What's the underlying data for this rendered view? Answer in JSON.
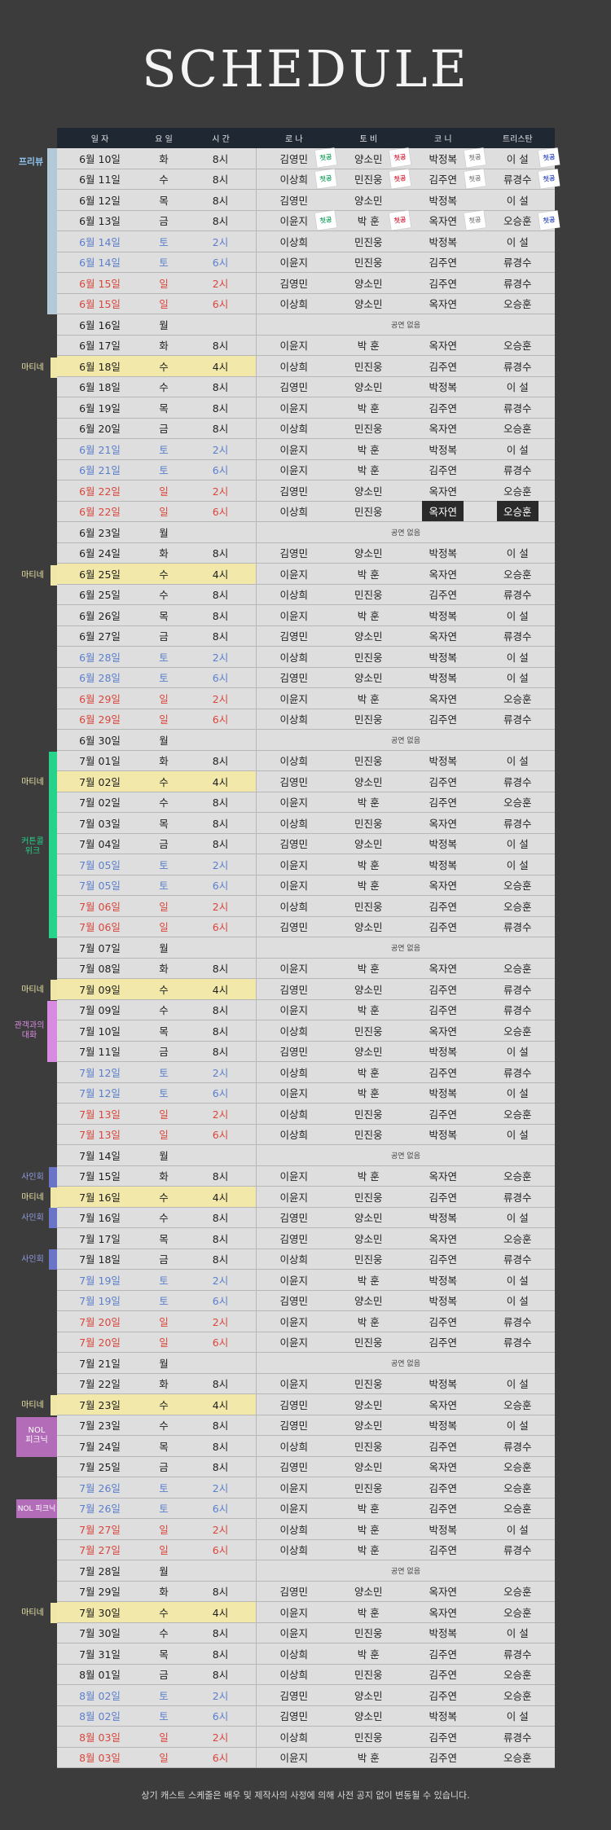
{
  "title": "SCHEDULE",
  "headers": [
    "일 자",
    "요 일",
    "시 간",
    "로 나",
    "토 비",
    "코 니",
    "트리스탄"
  ],
  "footer_note": "상기 캐스트 스케줄은 배우 및 제작사의 사정에 의해 사전 공지 없이 변동될 수 있습니다.",
  "side_labels": {
    "preview": "프리뷰",
    "matinee": "마티네",
    "curtain_call": [
      "커튼콜",
      "위크"
    ],
    "talk": [
      "관객과의",
      "대화"
    ],
    "signing": "사인회",
    "nol1": [
      "NOL",
      "피크닉"
    ],
    "nol2": "NOL 피크닉"
  },
  "colors": {
    "preview": "#b3c9d7",
    "matinee": "#efe6a7",
    "curtain_call": "#27d38a",
    "talk": "#d88be0",
    "signing": "#6b75c8",
    "nol": "#b36cb8"
  },
  "rows": [
    {
      "date": "6월 10일",
      "day": "화",
      "time": "8시",
      "cast": [
        "김영민",
        "양소민",
        "박정복",
        "이 설"
      ],
      "badges": [
        "green",
        "red",
        "gray",
        "blue"
      ]
    },
    {
      "date": "6월 11일",
      "day": "수",
      "time": "8시",
      "cast": [
        "이상희",
        "민진웅",
        "김주연",
        "류경수"
      ],
      "badges": [
        "green",
        "red",
        "gray",
        "blue"
      ]
    },
    {
      "date": "6월 12일",
      "day": "목",
      "time": "8시",
      "cast": [
        "김영민",
        "양소민",
        "박정복",
        "이 설"
      ]
    },
    {
      "date": "6월 13일",
      "day": "금",
      "time": "8시",
      "cast": [
        "이윤지",
        "박 훈",
        "옥자연",
        "오승훈"
      ],
      "badges": [
        "green",
        "red",
        "gray",
        "blue"
      ]
    },
    {
      "date": "6월 14일",
      "day": "토",
      "time": "2시",
      "type": "sat",
      "cast": [
        "이상희",
        "민진웅",
        "박정복",
        "이 설"
      ]
    },
    {
      "date": "6월 14일",
      "day": "토",
      "time": "6시",
      "type": "sat",
      "cast": [
        "이윤지",
        "민진웅",
        "김주연",
        "류경수"
      ]
    },
    {
      "date": "6월 15일",
      "day": "일",
      "time": "2시",
      "type": "sun",
      "cast": [
        "김영민",
        "양소민",
        "김주연",
        "류경수"
      ]
    },
    {
      "date": "6월 15일",
      "day": "일",
      "time": "6시",
      "type": "sun",
      "cast": [
        "이상희",
        "양소민",
        "옥자연",
        "오승훈"
      ]
    },
    {
      "date": "6월 16일",
      "day": "월",
      "off": "공연 없음"
    },
    {
      "date": "6월 17일",
      "day": "화",
      "time": "8시",
      "cast": [
        "이윤지",
        "박 훈",
        "옥자연",
        "오승훈"
      ]
    },
    {
      "date": "6월 18일",
      "day": "수",
      "time": "4시",
      "mat": true,
      "cast": [
        "이상희",
        "민진웅",
        "김주연",
        "류경수"
      ]
    },
    {
      "date": "6월 18일",
      "day": "수",
      "time": "8시",
      "cast": [
        "김영민",
        "양소민",
        "박정복",
        "이 설"
      ]
    },
    {
      "date": "6월 19일",
      "day": "목",
      "time": "8시",
      "cast": [
        "이윤지",
        "박 훈",
        "김주연",
        "류경수"
      ]
    },
    {
      "date": "6월 20일",
      "day": "금",
      "time": "8시",
      "cast": [
        "이상희",
        "민진웅",
        "옥자연",
        "오승훈"
      ]
    },
    {
      "date": "6월 21일",
      "day": "토",
      "time": "2시",
      "type": "sat",
      "cast": [
        "이윤지",
        "박 훈",
        "박정복",
        "이 설"
      ]
    },
    {
      "date": "6월 21일",
      "day": "토",
      "time": "6시",
      "type": "sat",
      "cast": [
        "이윤지",
        "박 훈",
        "김주연",
        "류경수"
      ]
    },
    {
      "date": "6월 22일",
      "day": "일",
      "time": "2시",
      "type": "sun",
      "cast": [
        "김영민",
        "양소민",
        "옥자연",
        "오승훈"
      ]
    },
    {
      "date": "6월 22일",
      "day": "일",
      "time": "6시",
      "type": "sun",
      "cast": [
        "이상희",
        "민진웅",
        "옥자연",
        "오승훈"
      ],
      "dark": [
        2,
        3
      ]
    },
    {
      "date": "6월 23일",
      "day": "월",
      "off": "공연 없음"
    },
    {
      "date": "6월 24일",
      "day": "화",
      "time": "8시",
      "cast": [
        "김영민",
        "양소민",
        "박정복",
        "이 설"
      ]
    },
    {
      "date": "6월 25일",
      "day": "수",
      "time": "4시",
      "mat": true,
      "cast": [
        "이윤지",
        "박 훈",
        "옥자연",
        "오승훈"
      ]
    },
    {
      "date": "6월 25일",
      "day": "수",
      "time": "8시",
      "cast": [
        "이상희",
        "민진웅",
        "김주연",
        "류경수"
      ]
    },
    {
      "date": "6월 26일",
      "day": "목",
      "time": "8시",
      "cast": [
        "이윤지",
        "박 훈",
        "박정복",
        "이 설"
      ]
    },
    {
      "date": "6월 27일",
      "day": "금",
      "time": "8시",
      "cast": [
        "김영민",
        "양소민",
        "옥자연",
        "류경수"
      ]
    },
    {
      "date": "6월 28일",
      "day": "토",
      "time": "2시",
      "type": "sat",
      "cast": [
        "이상희",
        "민진웅",
        "박정복",
        "이 설"
      ]
    },
    {
      "date": "6월 28일",
      "day": "토",
      "time": "6시",
      "type": "sat",
      "cast": [
        "김영민",
        "양소민",
        "박정복",
        "이 설"
      ]
    },
    {
      "date": "6월 29일",
      "day": "일",
      "time": "2시",
      "type": "sun",
      "cast": [
        "이윤지",
        "박 훈",
        "옥자연",
        "오승훈"
      ]
    },
    {
      "date": "6월 29일",
      "day": "일",
      "time": "6시",
      "type": "sun",
      "cast": [
        "이상희",
        "민진웅",
        "김주연",
        "류경수"
      ]
    },
    {
      "date": "6월 30일",
      "day": "월",
      "off": "공연 없음"
    },
    {
      "date": "7월 01일",
      "day": "화",
      "time": "8시",
      "cast": [
        "이상희",
        "민진웅",
        "박정복",
        "이 설"
      ]
    },
    {
      "date": "7월 02일",
      "day": "수",
      "time": "4시",
      "mat": true,
      "cast": [
        "김영민",
        "양소민",
        "김주연",
        "류경수"
      ]
    },
    {
      "date": "7월 02일",
      "day": "수",
      "time": "8시",
      "cast": [
        "이윤지",
        "박 훈",
        "김주연",
        "오승훈"
      ]
    },
    {
      "date": "7월 03일",
      "day": "목",
      "time": "8시",
      "cast": [
        "이상희",
        "민진웅",
        "옥자연",
        "류경수"
      ]
    },
    {
      "date": "7월 04일",
      "day": "금",
      "time": "8시",
      "cast": [
        "김영민",
        "양소민",
        "박정복",
        "이 설"
      ]
    },
    {
      "date": "7월 05일",
      "day": "토",
      "time": "2시",
      "type": "sat",
      "cast": [
        "이윤지",
        "박 훈",
        "박정복",
        "이 설"
      ]
    },
    {
      "date": "7월 05일",
      "day": "토",
      "time": "6시",
      "type": "sat",
      "cast": [
        "이윤지",
        "박 훈",
        "옥자연",
        "오승훈"
      ]
    },
    {
      "date": "7월 06일",
      "day": "일",
      "time": "2시",
      "type": "sun",
      "cast": [
        "이상희",
        "민진웅",
        "김주연",
        "오승훈"
      ]
    },
    {
      "date": "7월 06일",
      "day": "일",
      "time": "6시",
      "type": "sun",
      "cast": [
        "김영민",
        "양소민",
        "김주연",
        "류경수"
      ]
    },
    {
      "date": "7월 07일",
      "day": "월",
      "off": "공연 없음"
    },
    {
      "date": "7월 08일",
      "day": "화",
      "time": "8시",
      "cast": [
        "이윤지",
        "박 훈",
        "옥자연",
        "오승훈"
      ]
    },
    {
      "date": "7월 09일",
      "day": "수",
      "time": "4시",
      "mat": true,
      "cast": [
        "김영민",
        "양소민",
        "김주연",
        "류경수"
      ]
    },
    {
      "date": "7월 09일",
      "day": "수",
      "time": "8시",
      "cast": [
        "이윤지",
        "박 훈",
        "김주연",
        "류경수"
      ]
    },
    {
      "date": "7월 10일",
      "day": "목",
      "time": "8시",
      "cast": [
        "이상희",
        "민진웅",
        "옥자연",
        "오승훈"
      ]
    },
    {
      "date": "7월 11일",
      "day": "금",
      "time": "8시",
      "cast": [
        "김영민",
        "양소민",
        "박정복",
        "이 설"
      ]
    },
    {
      "date": "7월 12일",
      "day": "토",
      "time": "2시",
      "type": "sat",
      "cast": [
        "이상희",
        "박 훈",
        "김주연",
        "류경수"
      ]
    },
    {
      "date": "7월 12일",
      "day": "토",
      "time": "6시",
      "type": "sat",
      "cast": [
        "이윤지",
        "박 훈",
        "박정복",
        "이 설"
      ]
    },
    {
      "date": "7월 13일",
      "day": "일",
      "time": "2시",
      "type": "sun",
      "cast": [
        "이상희",
        "민진웅",
        "김주연",
        "오승훈"
      ]
    },
    {
      "date": "7월 13일",
      "day": "일",
      "time": "6시",
      "type": "sun",
      "cast": [
        "이상희",
        "민진웅",
        "박정복",
        "이 설"
      ]
    },
    {
      "date": "7월 14일",
      "day": "월",
      "off": "공연 없음"
    },
    {
      "date": "7월 15일",
      "day": "화",
      "time": "8시",
      "cast": [
        "이윤지",
        "박 훈",
        "옥자연",
        "오승훈"
      ]
    },
    {
      "date": "7월 16일",
      "day": "수",
      "time": "4시",
      "mat": true,
      "cast": [
        "이윤지",
        "민진웅",
        "김주연",
        "류경수"
      ]
    },
    {
      "date": "7월 16일",
      "day": "수",
      "time": "8시",
      "cast": [
        "김영민",
        "양소민",
        "박정복",
        "이 설"
      ]
    },
    {
      "date": "7월 17일",
      "day": "목",
      "time": "8시",
      "cast": [
        "김영민",
        "양소민",
        "옥자연",
        "오승훈"
      ]
    },
    {
      "date": "7월 18일",
      "day": "금",
      "time": "8시",
      "cast": [
        "이상희",
        "민진웅",
        "김주연",
        "류경수"
      ]
    },
    {
      "date": "7월 19일",
      "day": "토",
      "time": "2시",
      "type": "sat",
      "cast": [
        "이윤지",
        "박 훈",
        "박정복",
        "이 설"
      ]
    },
    {
      "date": "7월 19일",
      "day": "토",
      "time": "6시",
      "type": "sat",
      "cast": [
        "김영민",
        "양소민",
        "박정복",
        "이 설"
      ]
    },
    {
      "date": "7월 20일",
      "day": "일",
      "time": "2시",
      "type": "sun",
      "cast": [
        "이윤지",
        "박 훈",
        "김주연",
        "류경수"
      ]
    },
    {
      "date": "7월 20일",
      "day": "일",
      "time": "6시",
      "type": "sun",
      "cast": [
        "이윤지",
        "민진웅",
        "김주연",
        "류경수"
      ]
    },
    {
      "date": "7월 21일",
      "day": "월",
      "off": "공연 없음"
    },
    {
      "date": "7월 22일",
      "day": "화",
      "time": "8시",
      "cast": [
        "이윤지",
        "민진웅",
        "박정복",
        "이 설"
      ]
    },
    {
      "date": "7월 23일",
      "day": "수",
      "time": "4시",
      "mat": true,
      "cast": [
        "김영민",
        "양소민",
        "옥자연",
        "오승훈"
      ]
    },
    {
      "date": "7월 23일",
      "day": "수",
      "time": "8시",
      "cast": [
        "김영민",
        "양소민",
        "박정복",
        "이 설"
      ]
    },
    {
      "date": "7월 24일",
      "day": "목",
      "time": "8시",
      "cast": [
        "이상희",
        "민진웅",
        "김주연",
        "류경수"
      ]
    },
    {
      "date": "7월 25일",
      "day": "금",
      "time": "8시",
      "cast": [
        "김영민",
        "양소민",
        "옥자연",
        "오승훈"
      ]
    },
    {
      "date": "7월 26일",
      "day": "토",
      "time": "2시",
      "type": "sat",
      "cast": [
        "이윤지",
        "민진웅",
        "김주연",
        "오승훈"
      ]
    },
    {
      "date": "7월 26일",
      "day": "토",
      "time": "6시",
      "type": "sat",
      "cast": [
        "이윤지",
        "박 훈",
        "김주연",
        "오승훈"
      ]
    },
    {
      "date": "7월 27일",
      "day": "일",
      "time": "2시",
      "type": "sun",
      "cast": [
        "이상희",
        "박 훈",
        "박정복",
        "이 설"
      ]
    },
    {
      "date": "7월 27일",
      "day": "일",
      "time": "6시",
      "type": "sun",
      "cast": [
        "이상희",
        "박 훈",
        "김주연",
        "류경수"
      ]
    },
    {
      "date": "7월 28일",
      "day": "월",
      "off": "공연 없음"
    },
    {
      "date": "7월 29일",
      "day": "화",
      "time": "8시",
      "cast": [
        "김영민",
        "양소민",
        "옥자연",
        "오승훈"
      ]
    },
    {
      "date": "7월 30일",
      "day": "수",
      "time": "4시",
      "mat": true,
      "cast": [
        "이윤지",
        "박 훈",
        "옥자연",
        "오승훈"
      ]
    },
    {
      "date": "7월 30일",
      "day": "수",
      "time": "8시",
      "cast": [
        "이윤지",
        "민진웅",
        "박정복",
        "이 설"
      ]
    },
    {
      "date": "7월 31일",
      "day": "목",
      "time": "8시",
      "cast": [
        "이상희",
        "박 훈",
        "김주연",
        "류경수"
      ]
    },
    {
      "date": "8월 01일",
      "day": "금",
      "time": "8시",
      "cast": [
        "이상희",
        "민진웅",
        "김주연",
        "오승훈"
      ]
    },
    {
      "date": "8월 02일",
      "day": "토",
      "time": "2시",
      "type": "sat",
      "cast": [
        "김영민",
        "양소민",
        "김주연",
        "오승훈"
      ]
    },
    {
      "date": "8월 02일",
      "day": "토",
      "time": "6시",
      "type": "sat",
      "cast": [
        "김영민",
        "양소민",
        "박정복",
        "이 설"
      ]
    },
    {
      "date": "8월 03일",
      "day": "일",
      "time": "2시",
      "type": "sun",
      "cast": [
        "이상희",
        "민진웅",
        "김주연",
        "류경수"
      ]
    },
    {
      "date": "8월 03일",
      "day": "일",
      "time": "6시",
      "type": "sun",
      "cast": [
        "이윤지",
        "박 훈",
        "김주연",
        "오승훈"
      ]
    }
  ]
}
